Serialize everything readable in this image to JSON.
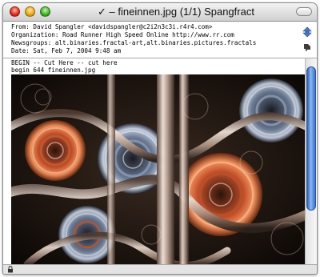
{
  "window": {
    "title": "✓ – fineinnen.jpg (1/1) Spangfract"
  },
  "headers": [
    "From: David Spangler <davidspangler@c2i2n3c3i.r4r4.com>",
    "Organization: Road Runner High Speed Online http://www.rr.com",
    "Newsgroups: alt.binaries.fractal-art,alt.binaries.pictures.fractals",
    "Date: Sat, Feb 7, 2004 9:48 am"
  ],
  "body": {
    "lines": [
      "BEGIN -- Cut Here -- cut here",
      "begin 644 fineinnen.jpg"
    ]
  },
  "icons": {
    "close": "close-button",
    "minimize": "minimize-button",
    "zoom": "zoom-button",
    "toolbar": "toolbar-toggle-button",
    "thread_nav": "up-down-arrows-icon",
    "spam": "thumbs-down-icon",
    "lock": "lock-icon"
  },
  "scrollbar": {
    "position": 0.0,
    "visible_fraction": 0.72
  }
}
